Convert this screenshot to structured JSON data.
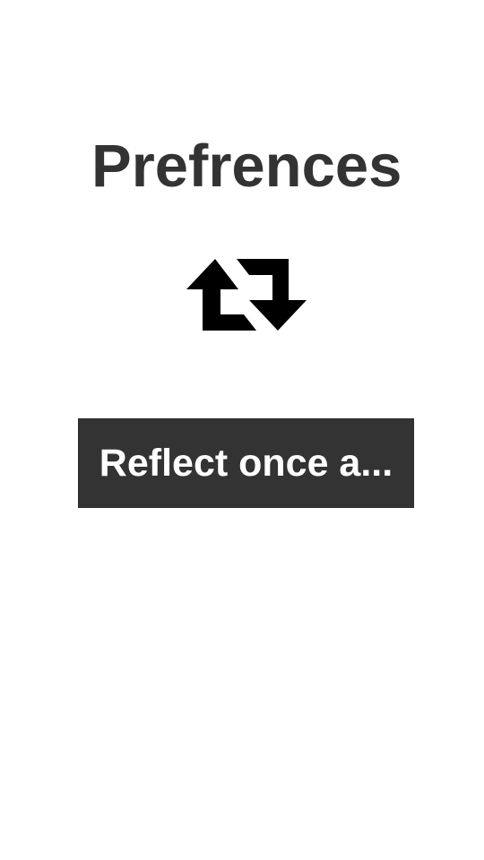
{
  "page": {
    "title": "Prefrences"
  },
  "icons": {
    "repeat": "repeat-arrows-icon"
  },
  "reminder": {
    "label": "Reflect once a..."
  },
  "colors": {
    "background": "#ffffff",
    "title": "#333333",
    "button_bg": "#333333",
    "button_text": "#ffffff",
    "icon": "#000000"
  }
}
